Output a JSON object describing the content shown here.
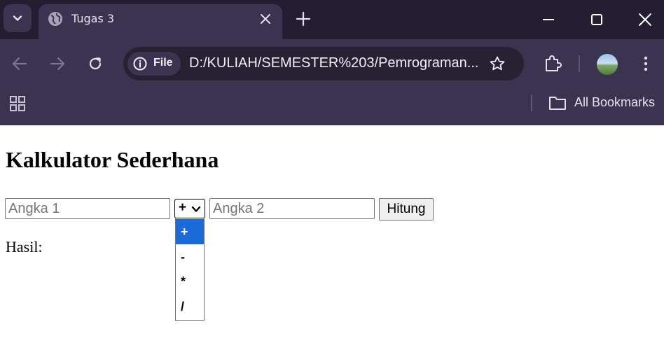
{
  "browser": {
    "tab_title": "Tugas 3",
    "url": "D:/KULIAH/SEMESTER%203/Pemrograman...",
    "security_chip": "File",
    "bookmarks_label": "All Bookmarks",
    "colors": {
      "frame": "#221d30",
      "toolbar": "#3b3451",
      "omnibox": "#272233"
    }
  },
  "page": {
    "title": "Kalkulator Sederhana",
    "input1_placeholder": "Angka 1",
    "operator_selected": "+",
    "operator_options": [
      "+",
      "-",
      "*",
      "/"
    ],
    "input2_placeholder": "Angka 2",
    "button_label": "Hitung",
    "result_label": "Hasil:",
    "highlight_color": "#1a6ad9"
  }
}
